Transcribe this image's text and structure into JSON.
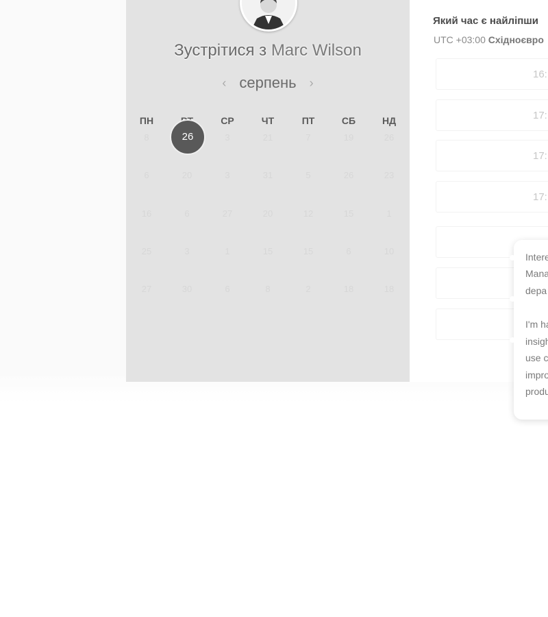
{
  "host": {
    "title_prefix": "Зустрітися з",
    "name": "Marc Wilson"
  },
  "calendar": {
    "month": "серпень",
    "prev_icon": "chevron-left-icon",
    "next_icon": "chevron-right-icon",
    "weekdays": [
      "ПН",
      "ВТ",
      "СР",
      "ЧТ",
      "ПТ",
      "СБ",
      "НД"
    ],
    "weeks": [
      [
        "8",
        "26",
        "3",
        "21",
        "7",
        "19",
        "26"
      ],
      [
        "6",
        "20",
        "3",
        "31",
        "5",
        "26",
        "23"
      ],
      [
        "16",
        "6",
        "27",
        "20",
        "12",
        "15",
        "1"
      ],
      [
        "25",
        "3",
        "1",
        "15",
        "15",
        "6",
        "10"
      ],
      [
        "27",
        "30",
        "6",
        "8",
        "2",
        "18",
        "18"
      ]
    ],
    "selected_day": "26"
  },
  "schedule": {
    "question": "Який час є найліпши",
    "timezone_offset": "UTC +03:00",
    "timezone_name": "Східноєвро",
    "slots": [
      "16:",
      "17:",
      "17:",
      "17:"
    ]
  },
  "popup": {
    "lines": [
      "Intere",
      "Mana",
      "depa",
      "",
      "I'm ha",
      "insigh",
      "use c",
      "impro",
      "produ"
    ]
  }
}
